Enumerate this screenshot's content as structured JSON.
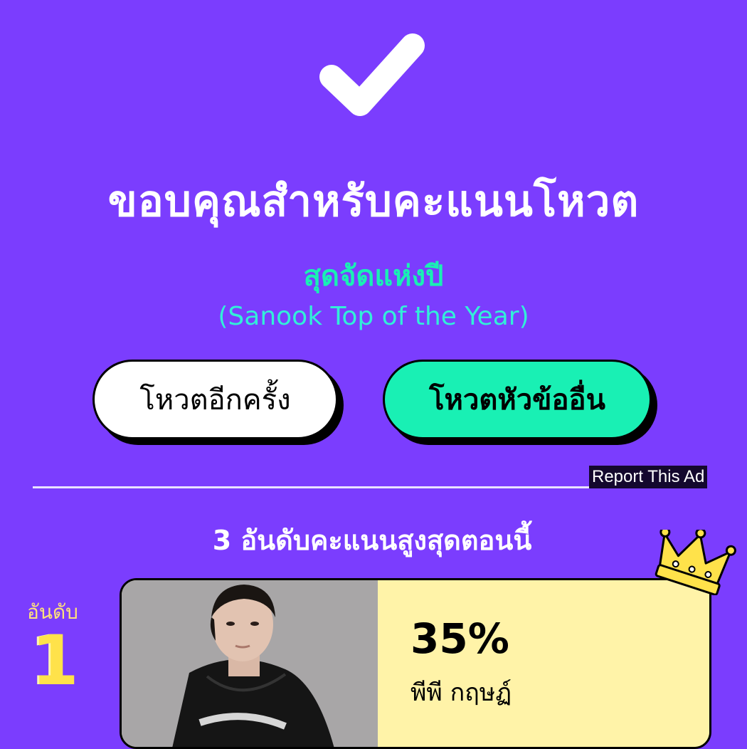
{
  "header": {
    "title": "ขอบคุณสำหรับคะแนนโหวต",
    "subtitle": "สุดจัดแห่งปี",
    "subtitle_en": "(Sanook Top of the Year)"
  },
  "buttons": {
    "vote_again": "โหวตอีกครั้ง",
    "vote_other": "โหวตหัวข้ออื่น"
  },
  "ad": {
    "report_label": "Report This Ad"
  },
  "ranking": {
    "heading": "3 อันดับคะแนนสูงสุดตอนนี้",
    "items": [
      {
        "rank_label": "อันดับ",
        "rank": "1",
        "percent": "35%",
        "percent_value": 35,
        "name": "พีพี กฤษฏ์"
      }
    ]
  },
  "colors": {
    "background": "#7b3dfe",
    "accent_green": "#19f0b4",
    "card_yellow": "#fff3a8",
    "rank_yellow": "#ffe24a"
  },
  "icons": [
    "check-icon",
    "crown-icon"
  ]
}
